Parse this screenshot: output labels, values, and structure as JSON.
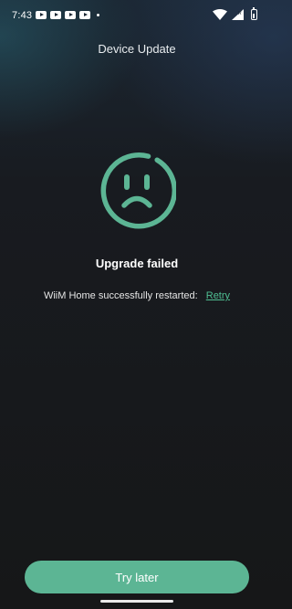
{
  "status_bar": {
    "time": "7:43",
    "notification_icons": [
      "youtube-icon",
      "youtube-icon",
      "youtube-icon",
      "youtube-icon"
    ],
    "right_icons": [
      "wifi-icon",
      "signal-icon",
      "battery-icon"
    ]
  },
  "header": {
    "title": "Device Update"
  },
  "result": {
    "icon": "sad-face-icon",
    "accent_color": "#5cb594",
    "title": "Upgrade failed",
    "message": "WiiM Home successfully restarted:",
    "retry_label": "Retry"
  },
  "footer": {
    "try_later_label": "Try later"
  }
}
